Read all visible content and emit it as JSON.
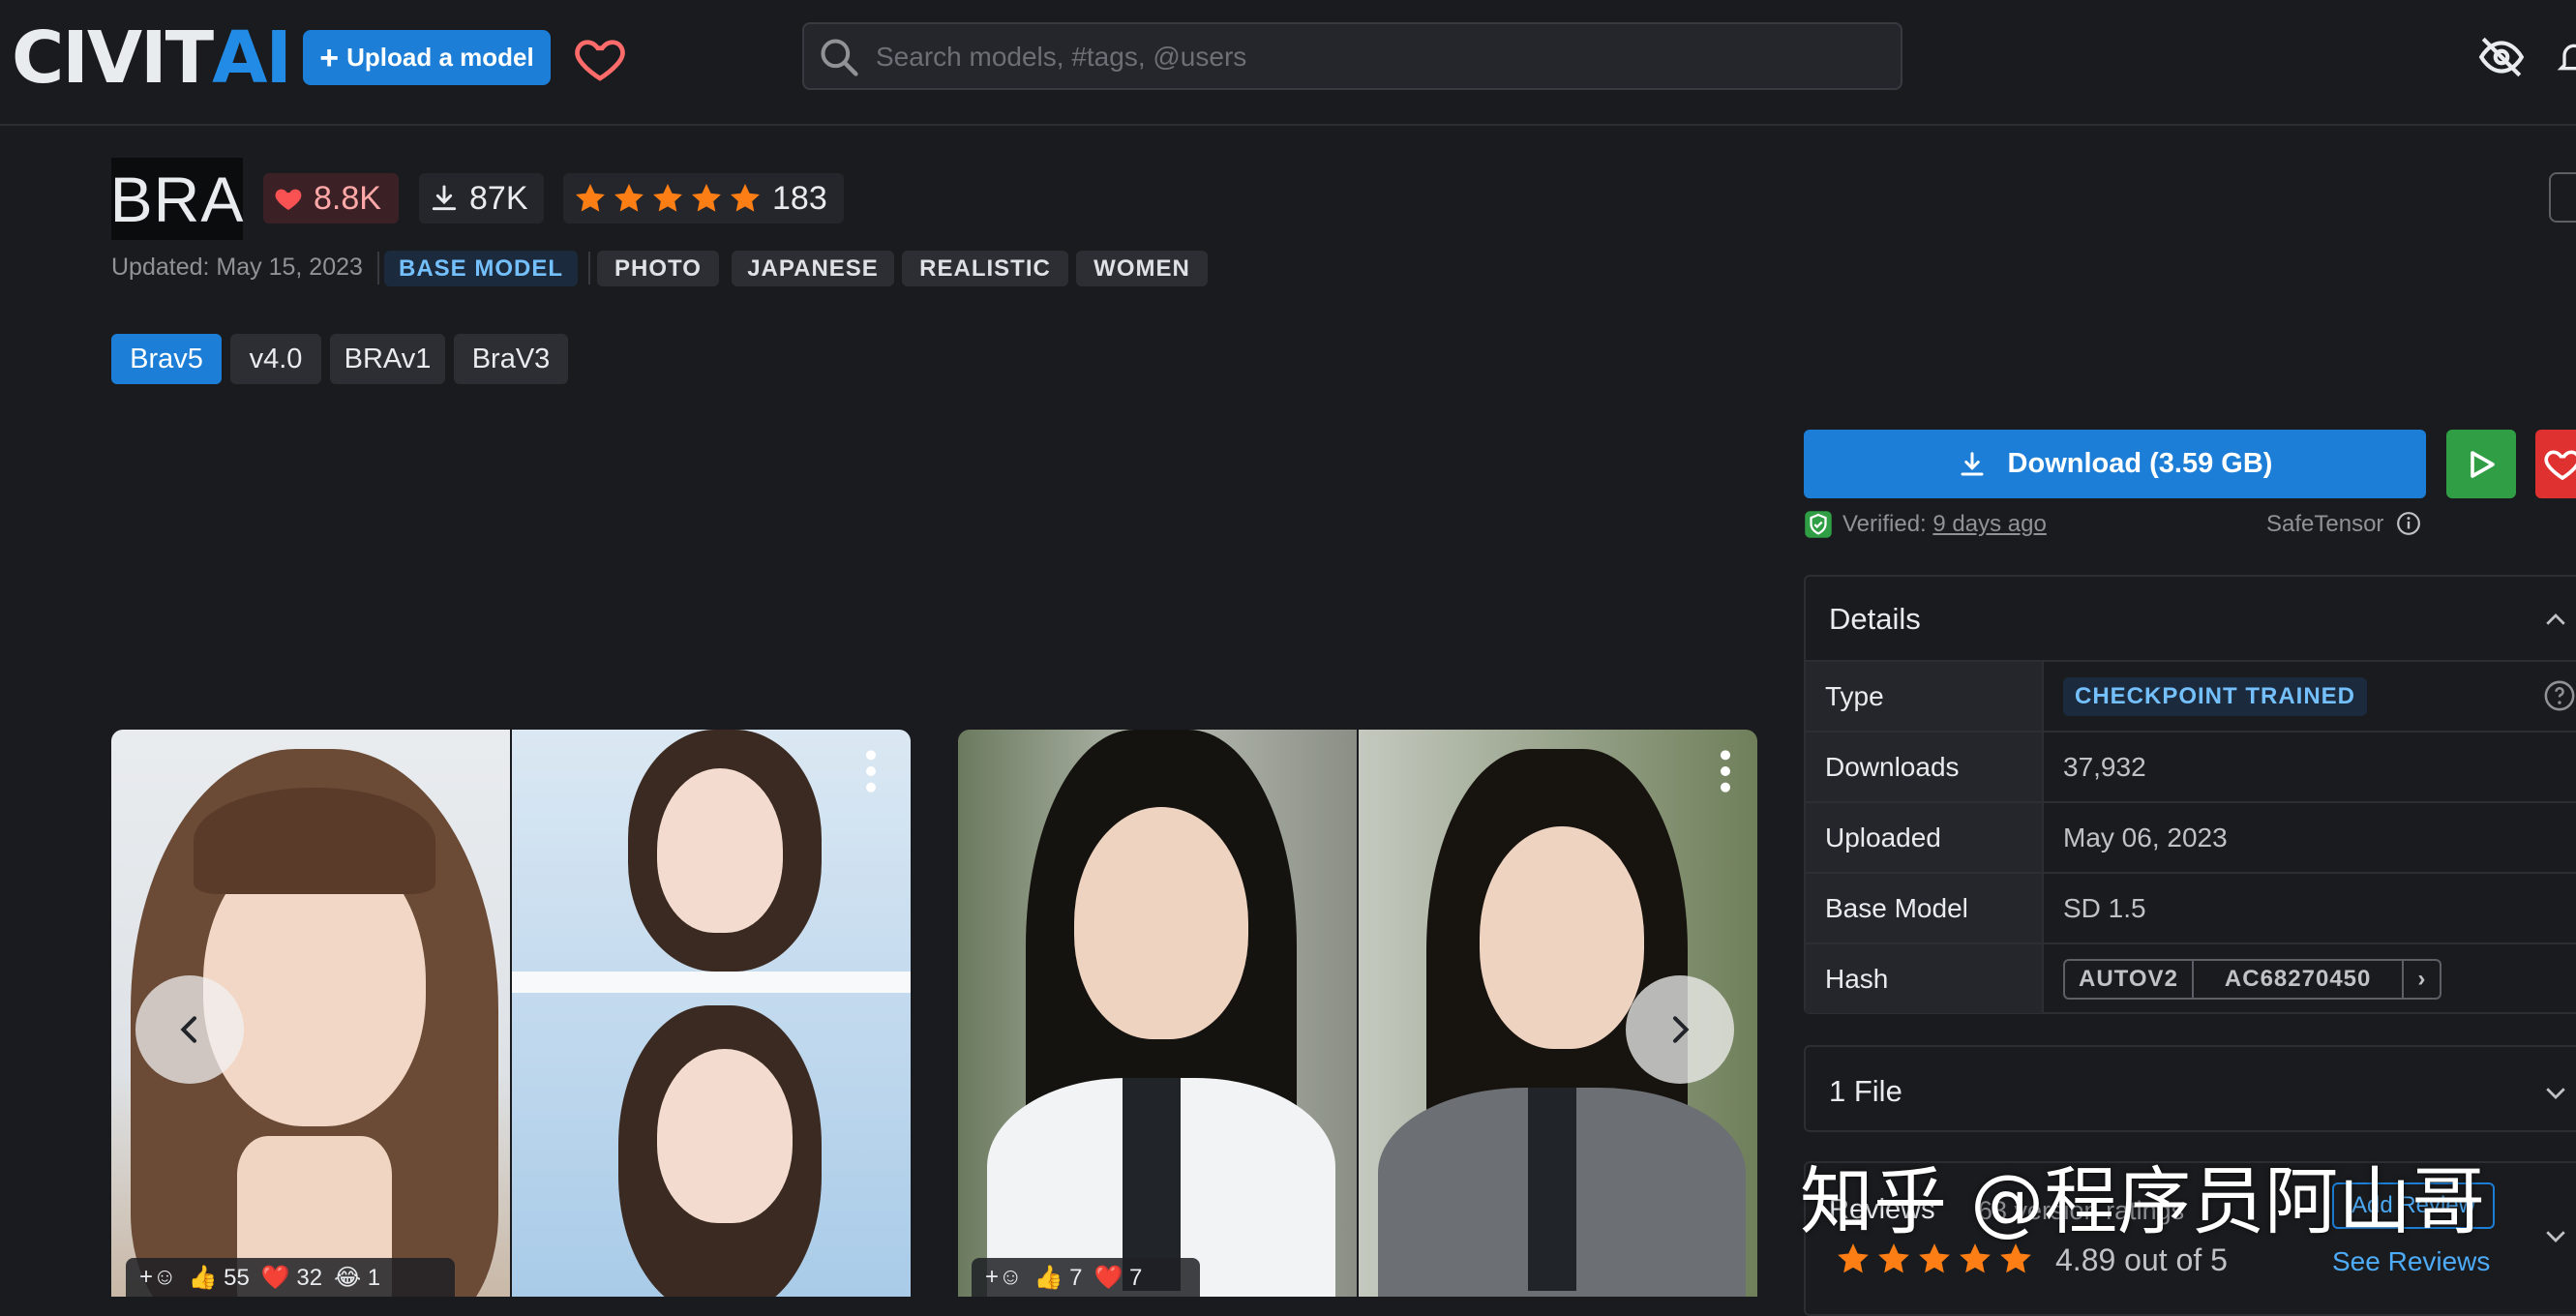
{
  "header": {
    "logo_main": "CIVIT",
    "logo_accent": "AI",
    "upload_label": "Upload a model",
    "search_placeholder": "Search models, #tags, @users"
  },
  "model": {
    "title": "BRA",
    "likes": "8.8K",
    "downloads": "87K",
    "rating_count": "183",
    "updated": "Updated: May 15, 2023",
    "base_tag": "BASE MODEL",
    "tags": [
      "PHOTO",
      "JAPANESE",
      "REALISTIC",
      "WOMEN"
    ],
    "versions": [
      "Brav5",
      "v4.0",
      "BRAv1",
      "BraV3"
    ],
    "active_version": "Brav5"
  },
  "gallery": {
    "cards": [
      {
        "reactions": {
          "like": "55",
          "heart": "32",
          "laugh": "1"
        }
      },
      {
        "reactions": {
          "like": "7",
          "heart": "7"
        }
      }
    ]
  },
  "sidebar": {
    "download_label": "Download (3.59 GB)",
    "verified_prefix": "Verified:",
    "verified_when": "9 days ago",
    "safetensor": "SafeTensor",
    "details": {
      "title": "Details",
      "rows": [
        {
          "label": "Type",
          "value": "CHECKPOINT TRAINED"
        },
        {
          "label": "Downloads",
          "value": "37,932"
        },
        {
          "label": "Uploaded",
          "value": "May 06, 2023"
        },
        {
          "label": "Base Model",
          "value": "SD 1.5"
        },
        {
          "label": "Hash",
          "value_type": "AUTOV2",
          "value": "AC68270450"
        }
      ]
    },
    "files_title": "1 File",
    "reviews": {
      "title": "Reviews",
      "count": "63 version ratings",
      "add_label": "Add Review",
      "score": "4.89 out of 5",
      "see_label": "See Reviews"
    }
  },
  "watermark": "知乎 @程序员阿山哥",
  "colors": {
    "background": "#1a1b1e",
    "primary": "#1c7ed6",
    "success": "#2f9e44",
    "danger": "#e03131",
    "star": "#fd7e14"
  }
}
